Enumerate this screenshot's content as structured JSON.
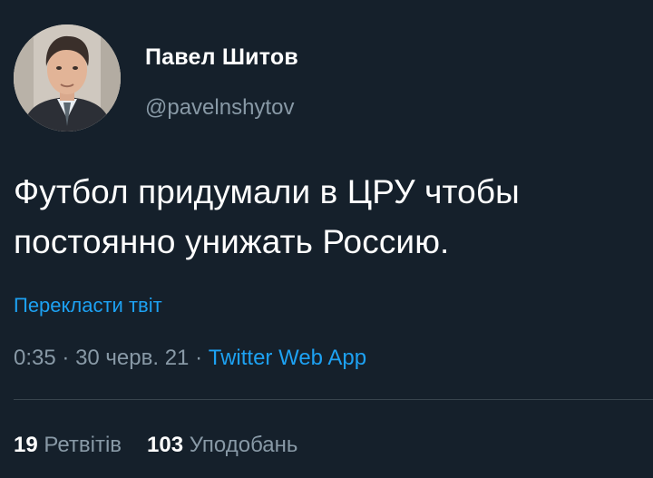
{
  "tweet": {
    "author_name": "Павел Шитов",
    "author_handle": "@pavelnshytov",
    "text": "Футбол придумали в ЦРУ чтобы постоянно унижать Россию.",
    "translate_label": "Перекласти твіт",
    "time": "0:35",
    "separator": "·",
    "date": "30 черв. 21",
    "source_app": "Twitter Web App",
    "retweets": {
      "count": "19",
      "label": "Ретвітів"
    },
    "likes": {
      "count": "103",
      "label": "Уподобань"
    }
  },
  "colors": {
    "background": "#15202b",
    "text": "#ffffff",
    "secondary": "#8899a6",
    "accent": "#1da1f2",
    "divider": "#38444d"
  },
  "icons": {
    "avatar": "profile-photo"
  }
}
